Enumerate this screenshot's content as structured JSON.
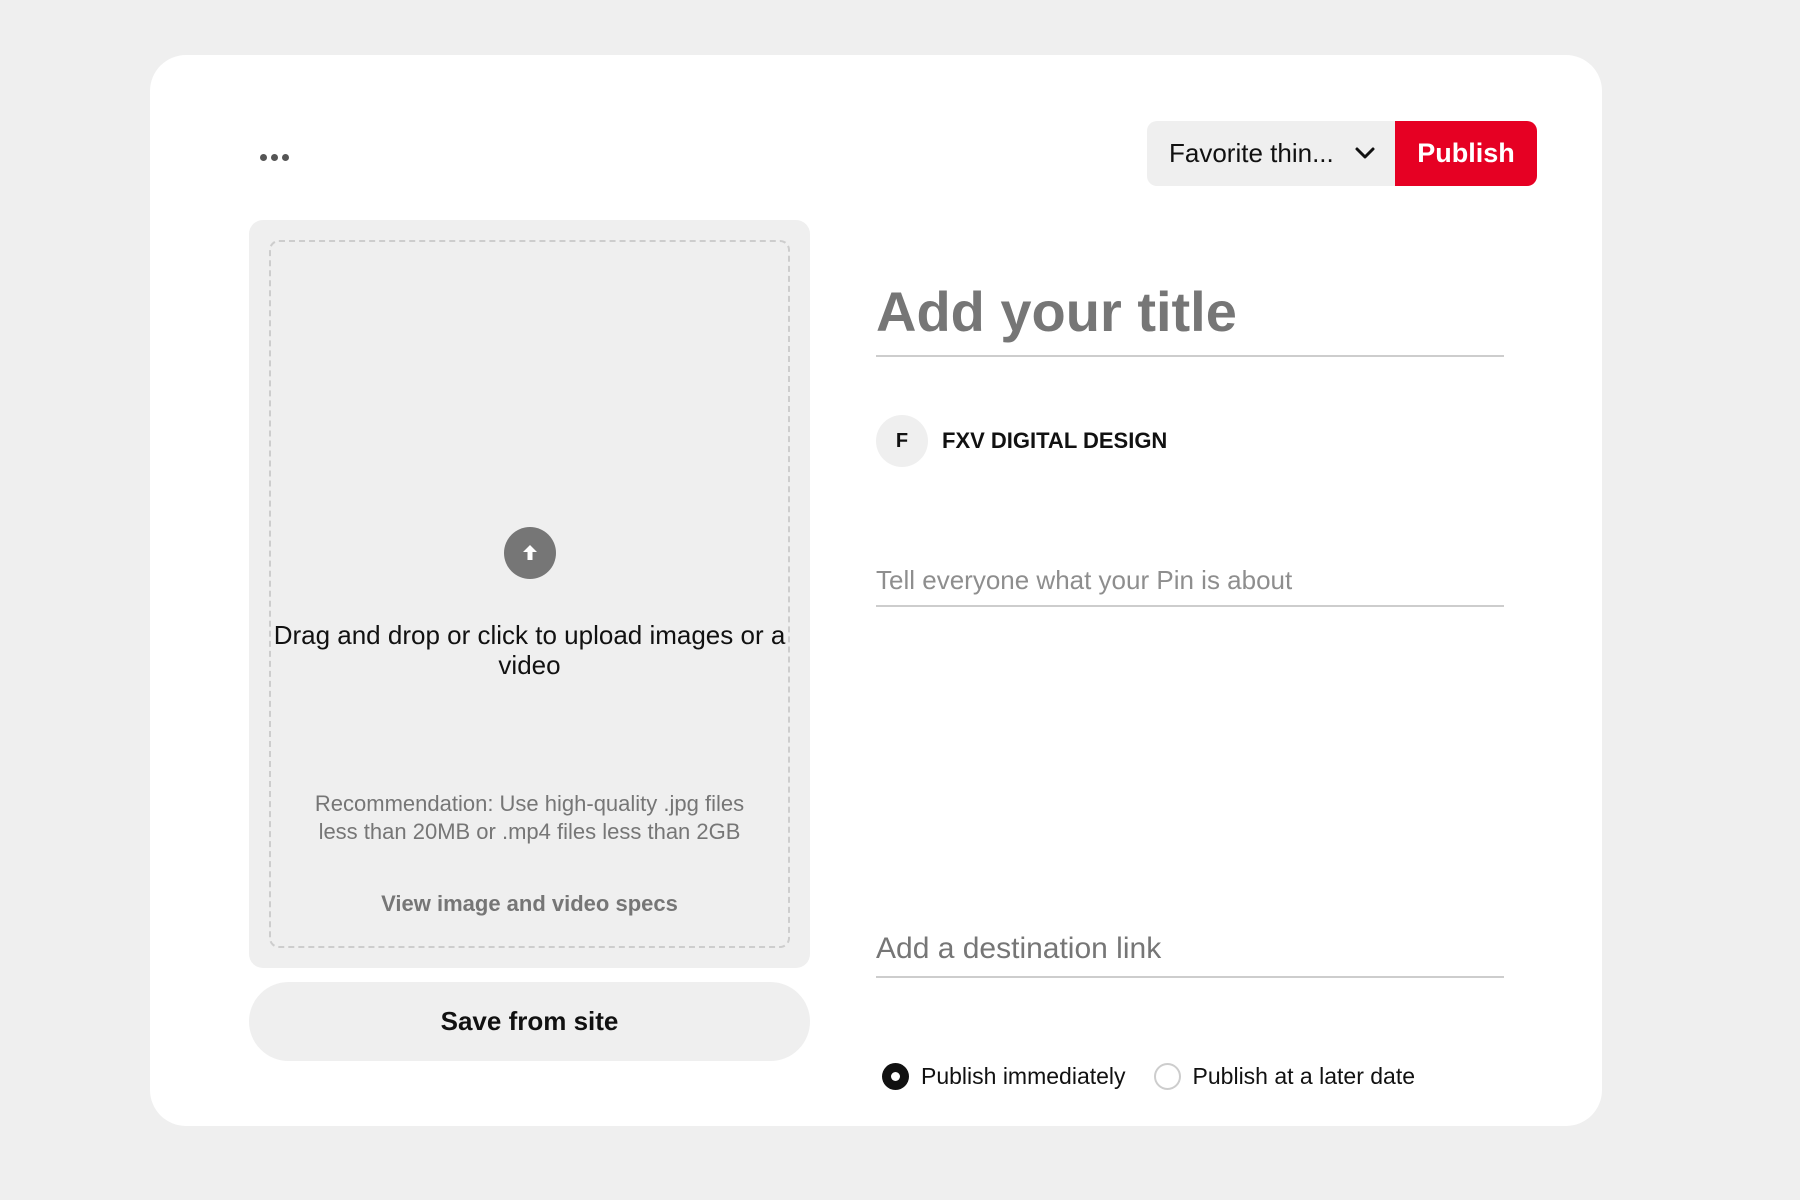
{
  "header": {
    "more_icon": "ellipsis-icon",
    "board_select": {
      "selected": "Favorite thin...",
      "icon": "chevron-down-icon"
    },
    "publish_label": "Publish",
    "publish_color": "#e60023"
  },
  "upload": {
    "icon": "arrow-up-icon",
    "main_text": "Drag and drop or click to upload images or a video",
    "recommendation": "Recommendation: Use high-quality .jpg files less than 20MB or .mp4 files less than 2GB",
    "specs_link": "View image and video specs",
    "save_from_site": "Save from site"
  },
  "form": {
    "title_placeholder": "Add your title",
    "owner": {
      "initial": "F",
      "name": "FXV DIGITAL DESIGN"
    },
    "description_placeholder": "Tell everyone what your Pin is about",
    "link_placeholder": "Add a destination link"
  },
  "publish_options": [
    {
      "label": "Publish immediately",
      "selected": true
    },
    {
      "label": "Publish at a later date",
      "selected": false
    }
  ]
}
